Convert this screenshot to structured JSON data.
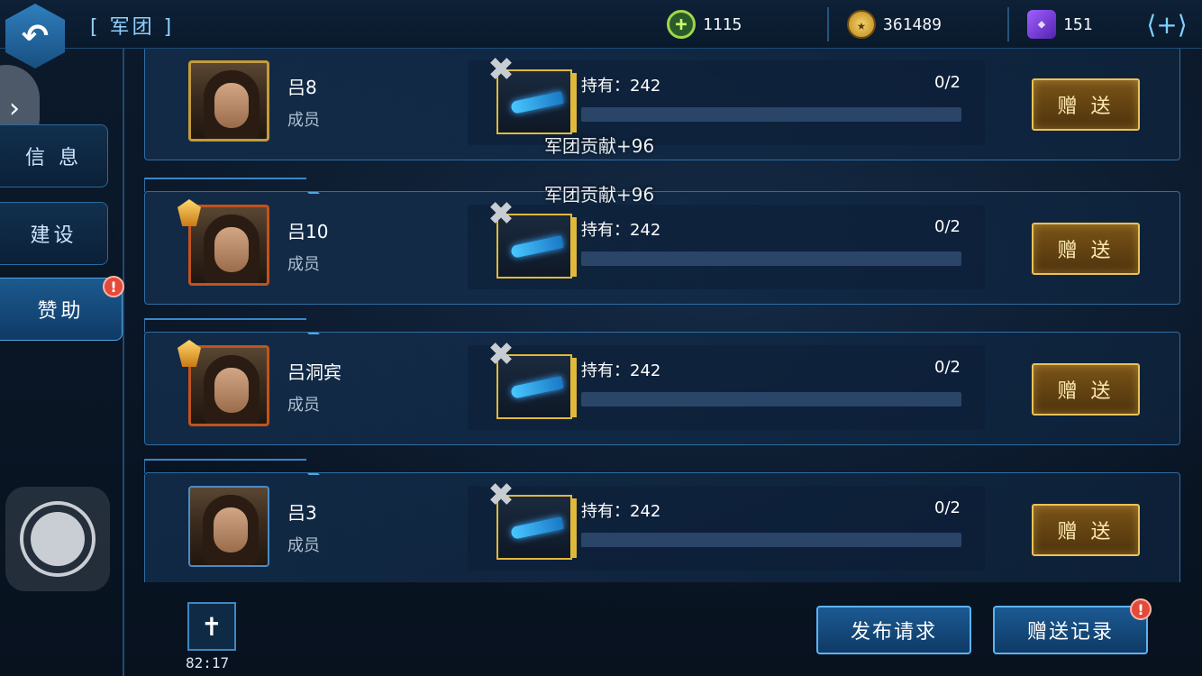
{
  "header": {
    "title": "[ 军团 ]",
    "back_icon": "back-arrow-icon",
    "resources": [
      {
        "name": "contribution",
        "icon": "cross-shield-icon",
        "value": "1115"
      },
      {
        "name": "coins",
        "icon": "star-coin-icon",
        "value": "361489"
      },
      {
        "name": "gems",
        "icon": "purple-gem-icon",
        "value": "151"
      }
    ],
    "add_label": "⟨+⟩"
  },
  "sidebar": {
    "tabs": [
      {
        "label": "信 息",
        "active": false
      },
      {
        "label": "建设",
        "active": false
      },
      {
        "label": "赞助",
        "active": true,
        "alert": "!"
      }
    ]
  },
  "members": [
    {
      "name": "吕8",
      "role": "成员",
      "hold": "持有：242",
      "count": "0/2",
      "progress": 0,
      "button": "赠 送",
      "frame": "gold"
    },
    {
      "name": "吕10",
      "role": "成员",
      "hold": "持有：242",
      "count": "0/2",
      "progress": 0,
      "button": "赠 送",
      "frame": "red"
    },
    {
      "name": "吕洞宾",
      "role": "成员",
      "hold": "持有：242",
      "count": "0/2",
      "progress": 0,
      "button": "赠 送",
      "frame": "red"
    },
    {
      "name": "吕3",
      "role": "成员",
      "hold": "持有：242",
      "count": "0/2",
      "progress": 0,
      "button": "赠 送",
      "frame": "blue"
    }
  ],
  "floating_texts": [
    "军团贡献+96",
    "军团贡献+96"
  ],
  "footer": {
    "publish_label": "发布请求",
    "history_label": "赠送记录",
    "history_alert": "!",
    "timer": "82:17"
  },
  "colors": {
    "accent": "#4fa6e6",
    "gold": "#e1b93a",
    "alert": "#e24a3a"
  }
}
